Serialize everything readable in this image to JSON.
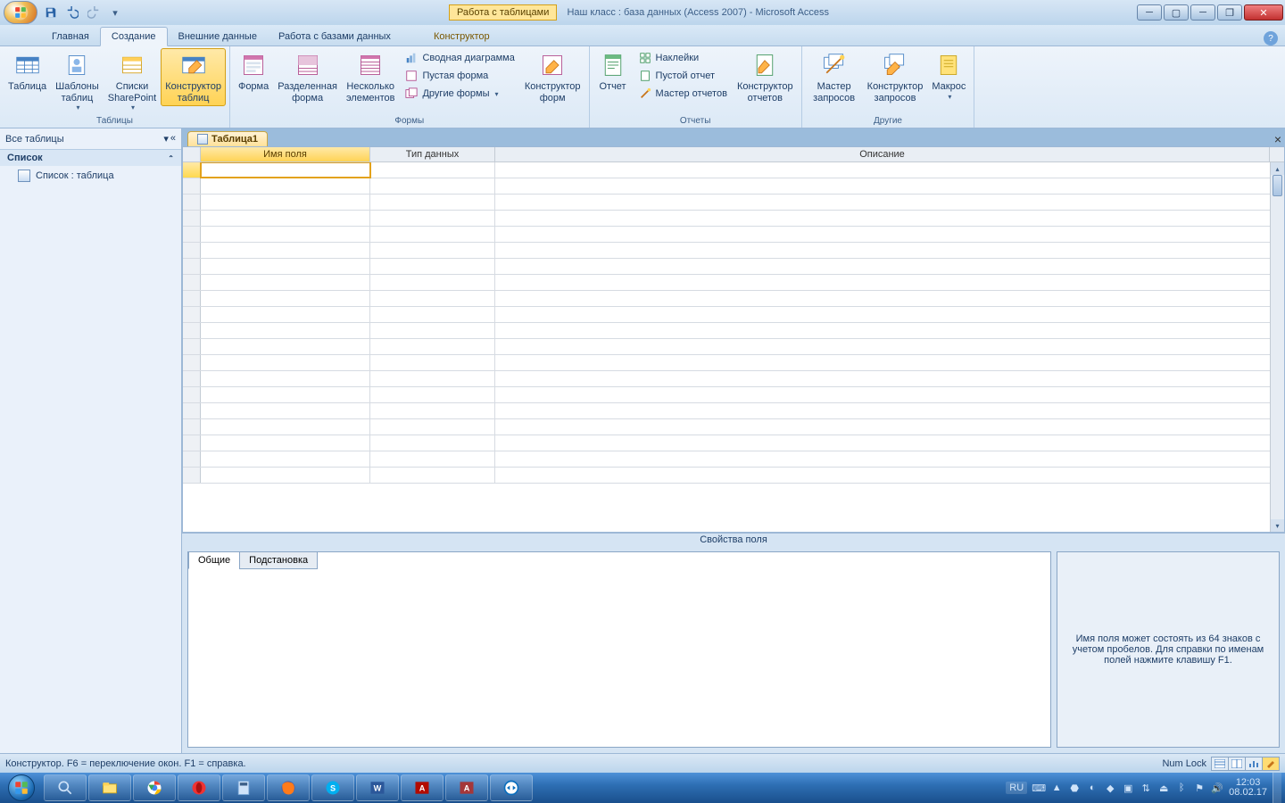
{
  "title": {
    "context_tab": "Работа с таблицами",
    "document": "Наш класс : база данных (Access 2007) - Microsoft Access"
  },
  "tabs": {
    "home": "Главная",
    "create": "Создание",
    "external": "Внешние данные",
    "dbtools": "Работа с базами данных",
    "design": "Конструктор"
  },
  "ribbon": {
    "groups": {
      "tables": "Таблицы",
      "forms": "Формы",
      "reports": "Отчеты",
      "other": "Другие"
    },
    "tables": {
      "table": "Таблица",
      "templates": "Шаблоны\nтаблиц",
      "sharepoint": "Списки\nSharePoint",
      "design": "Конструктор\nтаблиц"
    },
    "forms": {
      "form": "Форма",
      "split": "Разделенная\nформа",
      "multi": "Несколько\nэлементов",
      "pivot": "Сводная диаграмма",
      "blank": "Пустая форма",
      "more": "Другие формы",
      "design": "Конструктор\nформ"
    },
    "reports": {
      "report": "Отчет",
      "labels": "Наклейки",
      "blank": "Пустой отчет",
      "wizard": "Мастер отчетов",
      "design": "Конструктор\nотчетов"
    },
    "other": {
      "qwizard": "Мастер\nзапросов",
      "qdesign": "Конструктор\nзапросов",
      "macro": "Макрос"
    }
  },
  "nav": {
    "header": "Все таблицы",
    "group": "Список",
    "item": "Список : таблица"
  },
  "doc": {
    "tab": "Таблица1",
    "cols": {
      "name": "Имя поля",
      "type": "Тип данных",
      "desc": "Описание"
    }
  },
  "props": {
    "title": "Свойства поля",
    "general": "Общие",
    "lookup": "Подстановка",
    "hint": "Имя поля может состоять из 64 знаков с учетом пробелов.  Для справки по именам полей нажмите клавишу F1."
  },
  "status": {
    "left": "Конструктор.  F6 = переключение окон.  F1 = справка.",
    "numlock": "Num Lock"
  },
  "tray": {
    "lang": "RU",
    "time": "12:03",
    "date": "08.02.17"
  }
}
